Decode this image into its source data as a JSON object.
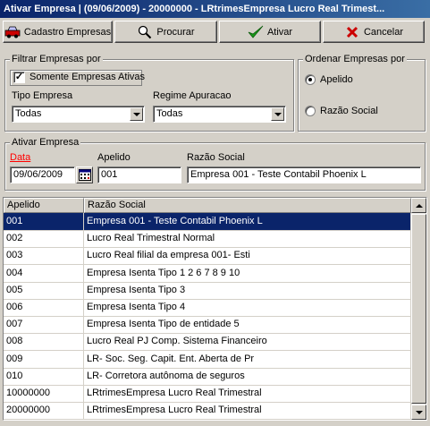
{
  "window": {
    "title": "Ativar Empresa  | (09/06/2009) - 20000000 - LRtrimesEmpresa Lucro Real Trimest..."
  },
  "toolbar": {
    "cadastro_label": "Cadastro Empresas",
    "procurar_label": "Procurar",
    "ativar_label": "Ativar",
    "cancelar_label": "Cancelar"
  },
  "filtrar": {
    "title": "Filtrar Empresas por",
    "somente_ativas_label": "Somente Empresas Ativas",
    "somente_ativas_checked": true,
    "tipo_label": "Tipo Empresa",
    "tipo_value": "Todas",
    "regime_label": "Regime Apuracao",
    "regime_value": "Todas"
  },
  "ordenar": {
    "title": "Ordenar Empresas por",
    "options": [
      {
        "label": "Apelido",
        "selected": true
      },
      {
        "label": "Razão Social",
        "selected": false
      }
    ]
  },
  "ativar": {
    "title": "Ativar Empresa",
    "data_label": "Data",
    "data_value": "09/06/2009",
    "apelido_label": "Apelido",
    "apelido_value": "001",
    "razao_label": "Razão Social",
    "razao_value": "Empresa 001 - Teste Contabil Phoenix L"
  },
  "grid": {
    "columns": [
      "Apelido",
      "Razão Social"
    ],
    "rows": [
      [
        "001",
        "Empresa 001 - Teste Contabil Phoenix L"
      ],
      [
        "002",
        "Lucro Real Trimestral Normal"
      ],
      [
        "003",
        "Lucro Real filial da empresa 001- Esti"
      ],
      [
        "004",
        "Empresa Isenta Tipo  1 2 6 7 8 9 10"
      ],
      [
        "005",
        "Empresa Isenta Tipo 3"
      ],
      [
        "006",
        "Empresa Isenta Tipo 4"
      ],
      [
        "007",
        "Empresa Isenta Tipo de entidade 5"
      ],
      [
        "008",
        "Lucro Real PJ Comp. Sistema Financeiro"
      ],
      [
        "009",
        "LR- Soc. Seg. Capit. Ent. Aberta de Pr"
      ],
      [
        "010",
        "LR- Corretora autônoma de seguros"
      ],
      [
        "10000000",
        "LRtrimesEmpresa Lucro Real Trimestral"
      ],
      [
        "20000000",
        "LRtrimesEmpresa Lucro Real Trimestral"
      ]
    ],
    "selected_index": 0
  },
  "colors": {
    "title_start": "#0a246a",
    "title_end": "#3a6ea5",
    "selection": "#0a246a",
    "required_label": "#ff0000"
  }
}
